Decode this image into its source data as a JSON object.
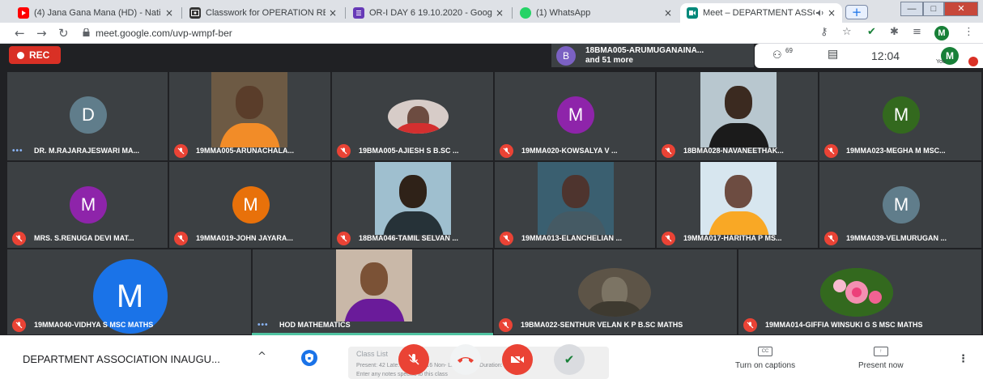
{
  "browser": {
    "tabs": [
      {
        "title": "(4) Jana Gana Mana (HD) - Nati",
        "close": "×"
      },
      {
        "title": "Classwork for OPERATION RESE",
        "close": "×"
      },
      {
        "title": "OR-I DAY 6 19.10.2020 - Googl",
        "close": "×"
      },
      {
        "title": "(1) WhatsApp",
        "close": "×"
      },
      {
        "title": "Meet – DEPARTMENT ASSC",
        "close": "×"
      }
    ],
    "new_tab": "+",
    "url": "meet.google.com/uvp-wmpf-ber",
    "profile_initial": "M"
  },
  "meet": {
    "rec_label": "REC",
    "presenter": {
      "initial": "B",
      "line1": "18BMA005-ARUMUGANAINA...",
      "line2": "and 51 more"
    },
    "people_count": "69",
    "time": "12:04",
    "you_label": "You",
    "you_initial": "M"
  },
  "participants": [
    {
      "name": "DR. M.RAJARAJESWARI MA...",
      "initial": "D",
      "color": "#607d8b",
      "muted": false
    },
    {
      "name": "19MMA005-ARUNACHALA...",
      "initial": "",
      "color": "",
      "muted": true
    },
    {
      "name": "19BMA005-AJIESH S B.SC ...",
      "initial": "",
      "color": "",
      "muted": true
    },
    {
      "name": "19MMA020-KOWSALYA V ...",
      "initial": "M",
      "color": "#8e24aa",
      "muted": true
    },
    {
      "name": "18BMA028-NAVANEETHAK...",
      "initial": "",
      "color": "",
      "muted": true
    },
    {
      "name": "19MMA023-MEGHA M MSC...",
      "initial": "M",
      "color": "#33691e",
      "muted": true
    },
    {
      "name": "MRS. S.RENUGA DEVI MAT...",
      "initial": "M",
      "color": "#8e24aa",
      "muted": true
    },
    {
      "name": "19MMA019-JOHN JAYARA...",
      "initial": "M",
      "color": "#e8710a",
      "muted": true
    },
    {
      "name": "18BMA046-TAMIL SELVAN ...",
      "initial": "",
      "color": "",
      "muted": true
    },
    {
      "name": "19MMA013-ELANCHELIAN ...",
      "initial": "",
      "color": "",
      "muted": true
    },
    {
      "name": "19MMA017-HARITHA P MS...",
      "initial": "",
      "color": "",
      "muted": true
    },
    {
      "name": "19MMA039-VELMURUGAN ...",
      "initial": "M",
      "color": "#607d8b",
      "muted": true
    },
    {
      "name": "19MMA040-VIDHYA S MSC MATHS",
      "initial": "M",
      "color": "#1a73e8",
      "muted": true
    },
    {
      "name": "HOD MATHEMATICS",
      "initial": "",
      "color": "",
      "muted": false
    },
    {
      "name": "19BMA022-SENTHUR VELAN K P B.SC MATHS",
      "initial": "",
      "color": "",
      "muted": true
    },
    {
      "name": "19MMA014-GIFFIA WINSUKI G S MSC MATHS",
      "initial": "",
      "color": "",
      "muted": true
    }
  ],
  "bottom": {
    "meeting_title": "DEPARTMENT ASSOCIATION INAUGU...",
    "chevron": "^",
    "overlay_title": "Class List",
    "overlay_hint": "Enter any notes specific to this class",
    "overlay_row": "Present: 42   Late: 0   Absent: 16   Non-   Late   Absent   Duration: 16",
    "captions_icon": "CC",
    "captions_label": "Turn on captions",
    "present_label": "Present now",
    "more": "⋮"
  },
  "colors": {
    "meet_dark": "#202124",
    "tile": "#3c4043",
    "red": "#ea4335",
    "green": "#188038",
    "blue": "#1a73e8"
  }
}
